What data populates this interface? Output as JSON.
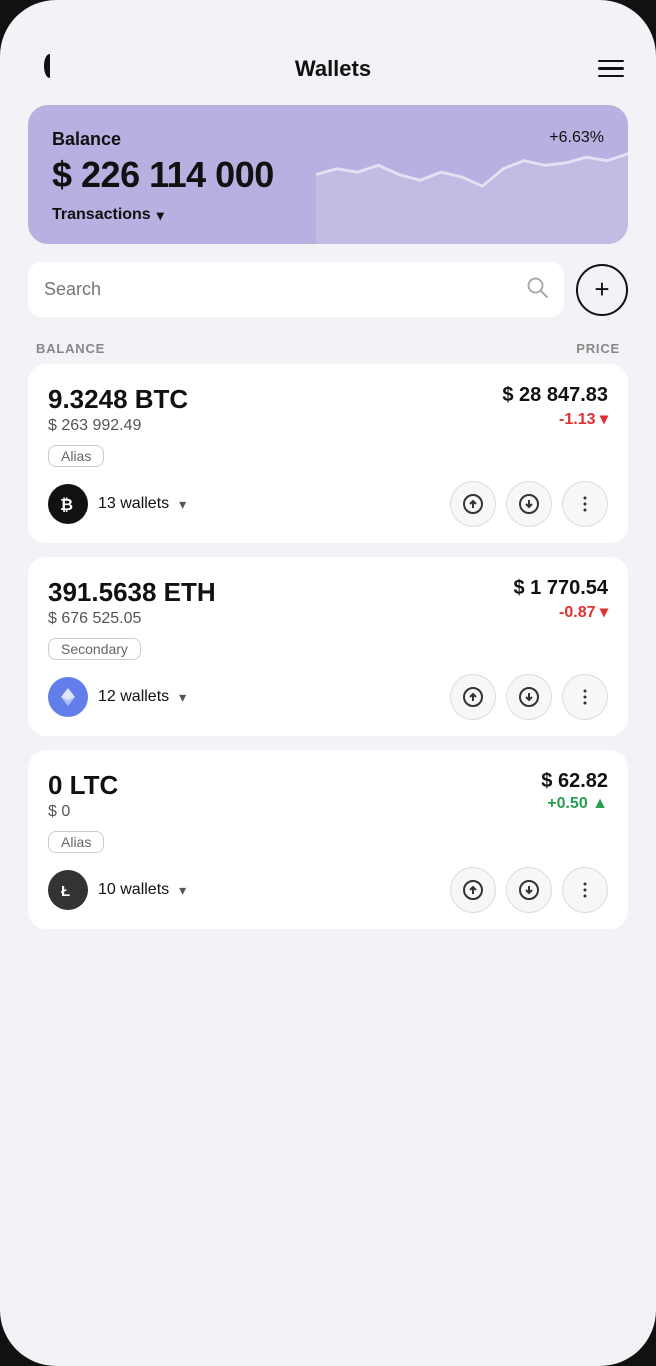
{
  "app": {
    "title": "Wallets"
  },
  "header": {
    "title": "Wallets",
    "menu_label": "menu"
  },
  "balance_card": {
    "label": "Balance",
    "percent": "+6.63%",
    "amount": "$ 226 114 000",
    "transactions_label": "Transactions"
  },
  "search": {
    "placeholder": "Search"
  },
  "add_button_label": "+",
  "columns": {
    "balance": "BALANCE",
    "price": "PRICE"
  },
  "coins": [
    {
      "amount": "9.3248 BTC",
      "usd_value": "$ 263 992.49",
      "price": "$ 28 847.83",
      "change": "-1.13 ▾",
      "change_type": "negative",
      "alias": "Alias",
      "wallets": "13 wallets",
      "logo_symbol": "₿",
      "logo_type": "btc",
      "id": "btc"
    },
    {
      "amount": "391.5638 ETH",
      "usd_value": "$ 676 525.05",
      "price": "$ 1 770.54",
      "change": "-0.87 ▾",
      "change_type": "negative",
      "alias": "Secondary",
      "wallets": "12 wallets",
      "logo_symbol": "⬡",
      "logo_type": "eth",
      "id": "eth"
    },
    {
      "amount": "0 LTC",
      "usd_value": "$ 0",
      "price": "$ 62.82",
      "change": "+0.50 ▲",
      "change_type": "positive",
      "alias": "Alias",
      "wallets": "10 wallets",
      "logo_symbol": "Ł",
      "logo_type": "ltc",
      "id": "ltc"
    }
  ]
}
